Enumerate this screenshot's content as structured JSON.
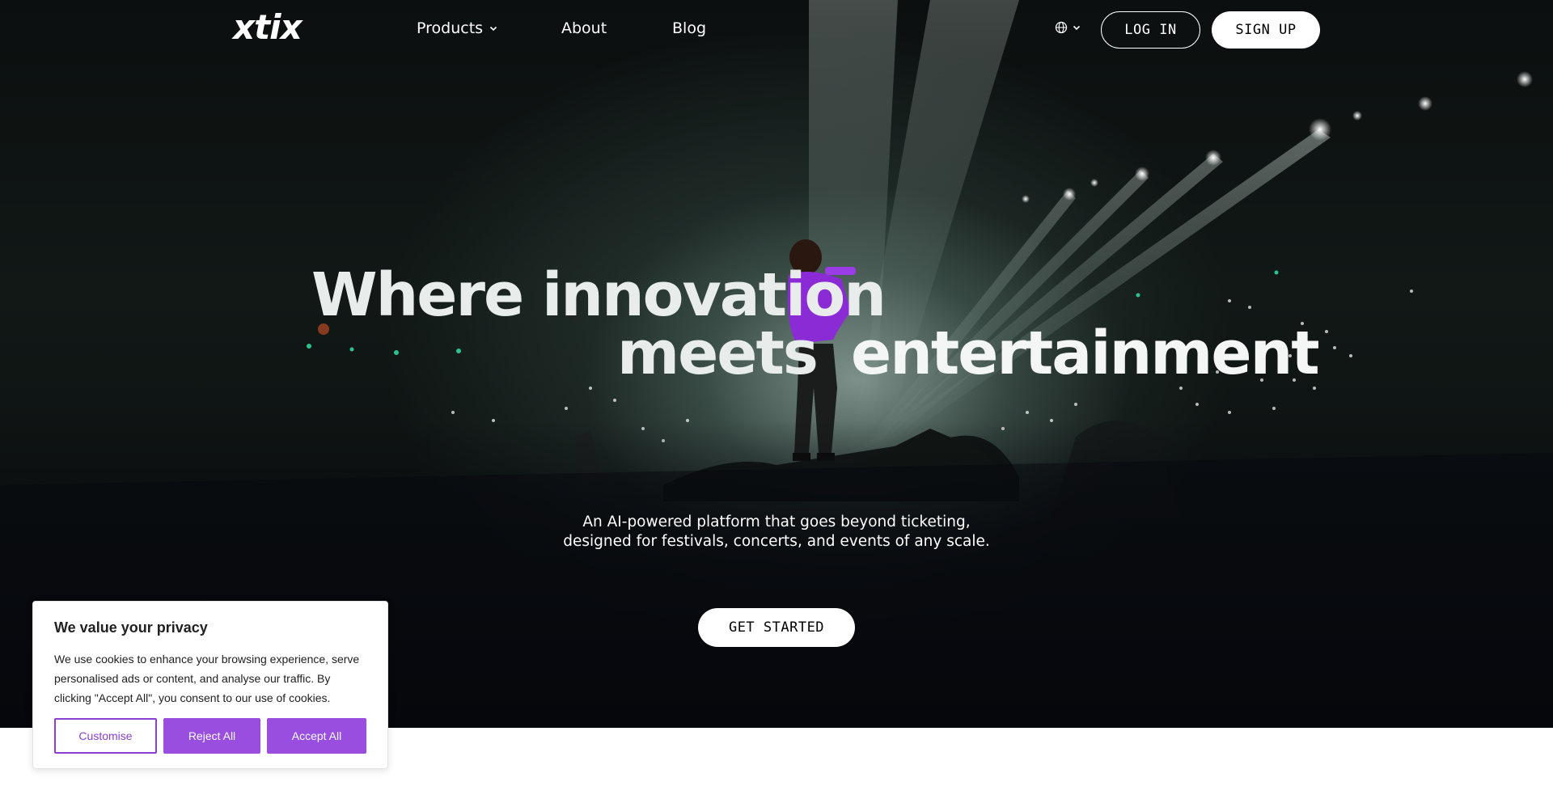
{
  "brand": {
    "logo": "xtix"
  },
  "nav": {
    "products": "Products",
    "about": "About",
    "blog": "Blog",
    "login": "LOG IN",
    "signup": "SIGN UP",
    "language_icon": "globe-icon"
  },
  "hero": {
    "headline_line1": "Where innovation",
    "headline_line2a": "meets",
    "headline_line2b": "entertainment",
    "subtitle_line1": "An AI-powered platform that goes beyond ticketing,",
    "subtitle_line2": "designed for festivals, concerts, and events of any scale.",
    "cta": "GET STARTED"
  },
  "cookie": {
    "title": "We value your privacy",
    "text": "We use cookies to enhance your browsing experience, serve personalised ads or content, and analyse our traffic. By clicking \"Accept All\", you consent to our use of cookies.",
    "customise": "Customise",
    "reject": "Reject All",
    "accept": "Accept All"
  },
  "colors": {
    "accent": "#9a4ee0",
    "performer_jacket": "#8b2bd6",
    "hero_dark": "#0b0f0f"
  }
}
